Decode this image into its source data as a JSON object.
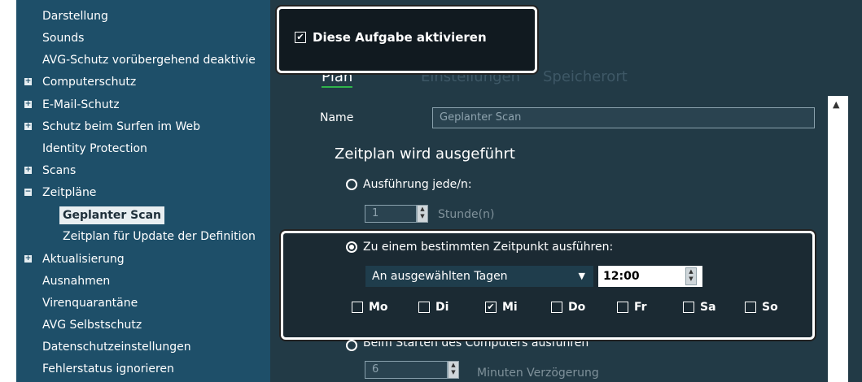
{
  "sidebar": {
    "items": [
      {
        "label": "Darstellung",
        "expander": ""
      },
      {
        "label": "Sounds",
        "expander": ""
      },
      {
        "label": "AVG-Schutz vorübergehend deaktivie",
        "expander": ""
      },
      {
        "label": "Computerschutz",
        "expander": "+"
      },
      {
        "label": "E-Mail-Schutz",
        "expander": "+"
      },
      {
        "label": "Schutz beim Surfen im Web",
        "expander": "+"
      },
      {
        "label": "Identity Protection",
        "expander": ""
      },
      {
        "label": "Scans",
        "expander": "+"
      },
      {
        "label": "Zeitpläne",
        "expander": "−"
      },
      {
        "label": "Geplanter Scan",
        "expander": ""
      },
      {
        "label": "Zeitplan für Update der Definition",
        "expander": ""
      },
      {
        "label": "Aktualisierung",
        "expander": "+"
      },
      {
        "label": "Ausnahmen",
        "expander": ""
      },
      {
        "label": "Virenquarantäne",
        "expander": ""
      },
      {
        "label": "AVG Selbstschutz",
        "expander": ""
      },
      {
        "label": "Datenschutzeinstellungen",
        "expander": ""
      },
      {
        "label": "Fehlerstatus ignorieren",
        "expander": ""
      }
    ]
  },
  "task": {
    "checkbox_mark": "✔",
    "label": "Diese Aufgabe aktivieren"
  },
  "tabs": [
    "Plan",
    "Einstellungen",
    "Speicherort"
  ],
  "form": {
    "name_label": "Name",
    "name_value": "Geplanter Scan",
    "section_title": "Zeitplan wird ausgeführt",
    "option_interval": "Ausführung jede/n:",
    "interval_value": "1",
    "interval_unit": "Stunde(n)",
    "option_specific": "Zu einem bestimmten Zeitpunkt ausführen:",
    "days_select": "An ausgewählten Tagen",
    "time_value": "12:00",
    "option_startup": "Beim Starten des Computers ausführen",
    "delay_value": "6",
    "delay_unit": "Minuten Verzögerung"
  },
  "days": [
    {
      "label": "Mo",
      "checked": false
    },
    {
      "label": "Di",
      "checked": false
    },
    {
      "label": "Mi",
      "checked": true
    },
    {
      "label": "Do",
      "checked": false
    },
    {
      "label": "Fr",
      "checked": false
    },
    {
      "label": "Sa",
      "checked": false
    },
    {
      "label": "So",
      "checked": false
    }
  ],
  "colors": {
    "sidebar": "#1e4f69",
    "main": "#223a46",
    "accent": "#2fb44a"
  }
}
